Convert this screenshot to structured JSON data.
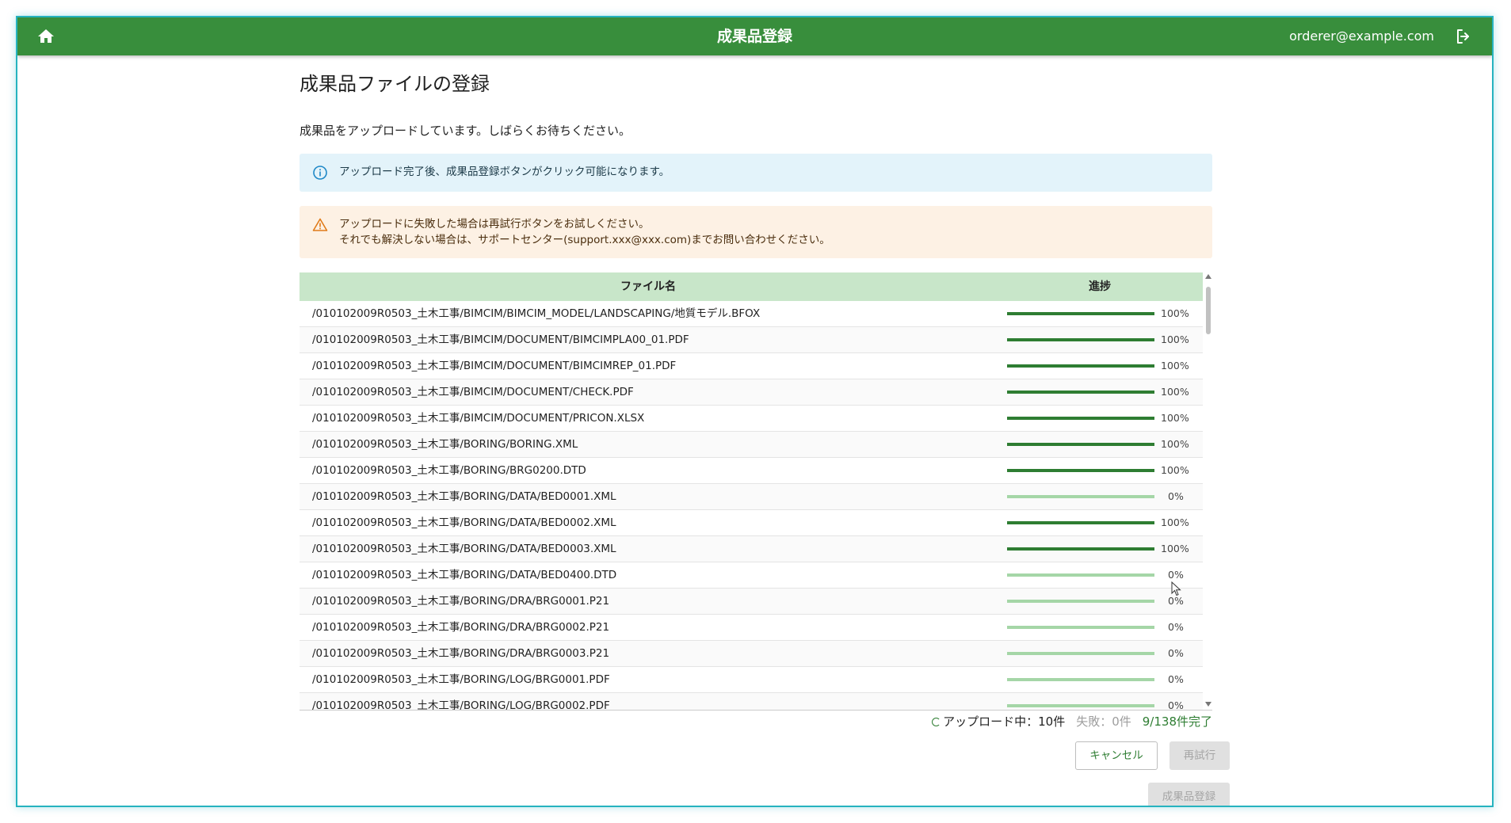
{
  "app": {
    "title": "成果品登録",
    "user_email": "orderer@example.com",
    "home_icon": "home-icon",
    "logout_icon": "logout-icon",
    "brand_color": "#388e3c"
  },
  "page": {
    "title": "成果品ファイルの登録",
    "lead": "成果品をアップロードしています。しばらくお待ちください。"
  },
  "alerts": {
    "info": {
      "icon": "info-icon",
      "text": "アップロード完了後、成果品登録ボタンがクリック可能になります。"
    },
    "warning": {
      "icon": "warning-icon",
      "line1": "アップロードに失敗した場合は再試行ボタンをお試しください。",
      "line2": "それでも解決しない場合は、サポートセンター(support.xxx@xxx.com)までお問い合わせください。"
    }
  },
  "table": {
    "headers": {
      "name": "ファイル名",
      "progress": "進捗"
    },
    "rows": [
      {
        "name": "/010102009R0503_土木工事/BIMCIM/BIMCIM_MODEL/LANDSCAPING/地質モデル.BFOX",
        "progress": 100,
        "label": "100%"
      },
      {
        "name": "/010102009R0503_土木工事/BIMCIM/DOCUMENT/BIMCIMPLA00_01.PDF",
        "progress": 100,
        "label": "100%"
      },
      {
        "name": "/010102009R0503_土木工事/BIMCIM/DOCUMENT/BIMCIMREP_01.PDF",
        "progress": 100,
        "label": "100%"
      },
      {
        "name": "/010102009R0503_土木工事/BIMCIM/DOCUMENT/CHECK.PDF",
        "progress": 100,
        "label": "100%"
      },
      {
        "name": "/010102009R0503_土木工事/BIMCIM/DOCUMENT/PRICON.XLSX",
        "progress": 100,
        "label": "100%"
      },
      {
        "name": "/010102009R0503_土木工事/BORING/BORING.XML",
        "progress": 100,
        "label": "100%"
      },
      {
        "name": "/010102009R0503_土木工事/BORING/BRG0200.DTD",
        "progress": 100,
        "label": "100%"
      },
      {
        "name": "/010102009R0503_土木工事/BORING/DATA/BED0001.XML",
        "progress": 0,
        "label": "0%"
      },
      {
        "name": "/010102009R0503_土木工事/BORING/DATA/BED0002.XML",
        "progress": 100,
        "label": "100%"
      },
      {
        "name": "/010102009R0503_土木工事/BORING/DATA/BED0003.XML",
        "progress": 100,
        "label": "100%"
      },
      {
        "name": "/010102009R0503_土木工事/BORING/DATA/BED0400.DTD",
        "progress": 0,
        "label": "0%"
      },
      {
        "name": "/010102009R0503_土木工事/BORING/DRA/BRG0001.P21",
        "progress": 0,
        "label": "0%"
      },
      {
        "name": "/010102009R0503_土木工事/BORING/DRA/BRG0002.P21",
        "progress": 0,
        "label": "0%"
      },
      {
        "name": "/010102009R0503_土木工事/BORING/DRA/BRG0003.P21",
        "progress": 0,
        "label": "0%"
      },
      {
        "name": "/010102009R0503_土木工事/BORING/LOG/BRG0001.PDF",
        "progress": 0,
        "label": "0%"
      },
      {
        "name": "/010102009R0503_土木工事/BORING/LOG/BRG0002.PDF",
        "progress": 0,
        "label": "0%"
      }
    ]
  },
  "status": {
    "uploading": "アップロード中：10件",
    "failed": "失敗：0件",
    "done": "9/138件完了"
  },
  "buttons": {
    "cancel": "キャンセル",
    "retry": "再試行",
    "register": "成果品登録"
  }
}
